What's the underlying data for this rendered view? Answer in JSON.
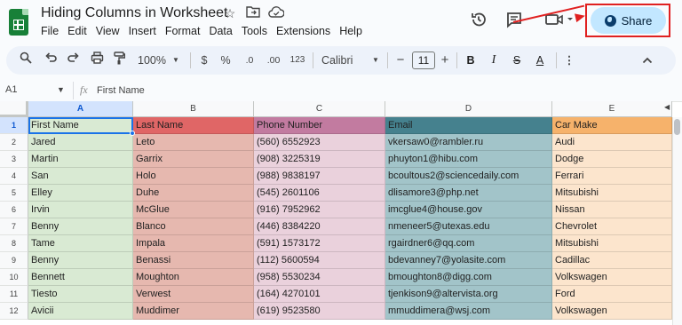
{
  "header": {
    "title": "Hiding Columns in Worksheet",
    "menu": [
      "File",
      "Edit",
      "View",
      "Insert",
      "Format",
      "Data",
      "Tools",
      "Extensions",
      "Help"
    ],
    "share_label": "Share"
  },
  "toolbar": {
    "zoom": "100%",
    "currency": "$",
    "percent": "%",
    "dec_decrease": ".0",
    "dec_increase": ".00",
    "number_format": "123",
    "font": "Calibri",
    "font_size": "11",
    "bold": "B",
    "italic": "I",
    "strike": "S",
    "text_color": "A"
  },
  "formula_bar": {
    "cell_ref": "A1",
    "fx": "fx",
    "content": "First Name"
  },
  "sheet": {
    "columns": [
      "A",
      "B",
      "C",
      "D",
      "E"
    ],
    "column_colors": {
      "header": [
        "#d9ead3",
        "#e06666",
        "#c27ba0",
        "#45818e",
        "#f6b26b"
      ],
      "body": [
        "#d9ead3",
        "#e6b8af",
        "#ead1dc",
        "#a2c4c9",
        "#fce5cd"
      ]
    },
    "rows": [
      {
        "num": "1",
        "cells": [
          "First Name",
          "Last Name",
          "Phone Number",
          "Email",
          "Car Make"
        ]
      },
      {
        "num": "2",
        "cells": [
          "Jared",
          "Leto",
          "(560) 6552923",
          "vkersaw0@rambler.ru",
          "Audi"
        ]
      },
      {
        "num": "3",
        "cells": [
          "Martin",
          "Garrix",
          "(908) 3225319",
          "phuyton1@hibu.com",
          "Dodge"
        ]
      },
      {
        "num": "4",
        "cells": [
          "San",
          "Holo",
          "(988) 9838197",
          "bcoultous2@sciencedaily.com",
          "Ferrari"
        ]
      },
      {
        "num": "5",
        "cells": [
          "Elley",
          "Duhe",
          "(545) 2601106",
          "dlisamore3@php.net",
          "Mitsubishi"
        ]
      },
      {
        "num": "6",
        "cells": [
          "Irvin",
          "McGlue",
          "(916) 7952962",
          "imcglue4@house.gov",
          "Nissan"
        ]
      },
      {
        "num": "7",
        "cells": [
          "Benny",
          "Blanco",
          "(446) 8384220",
          "nmeneer5@utexas.edu",
          "Chevrolet"
        ]
      },
      {
        "num": "8",
        "cells": [
          "Tame",
          "Impala",
          "(591) 1573172",
          "rgairdner6@qq.com",
          "Mitsubishi"
        ]
      },
      {
        "num": "9",
        "cells": [
          "Benny",
          "Benassi",
          "(112) 5600594",
          "bdevanney7@yolasite.com",
          "Cadillac"
        ]
      },
      {
        "num": "10",
        "cells": [
          "Bennett",
          "Moughton",
          "(958) 5530234",
          "bmoughton8@digg.com",
          "Volkswagen"
        ]
      },
      {
        "num": "11",
        "cells": [
          "Tiesto",
          "Verwest",
          "(164) 4270101",
          "tjenkison9@altervista.org",
          "Ford"
        ]
      },
      {
        "num": "12",
        "cells": [
          "Avicii",
          "Muddimer",
          "(619) 9523580",
          "mmuddimera@wsj.com",
          "Volkswagen"
        ]
      }
    ]
  },
  "icons": {
    "star": "star-icon",
    "move": "folder-move-icon",
    "cloud": "cloud-status-icon",
    "history": "history-icon",
    "comments": "comment-icon",
    "meet": "video-camera-icon",
    "share": "globe-icon"
  }
}
